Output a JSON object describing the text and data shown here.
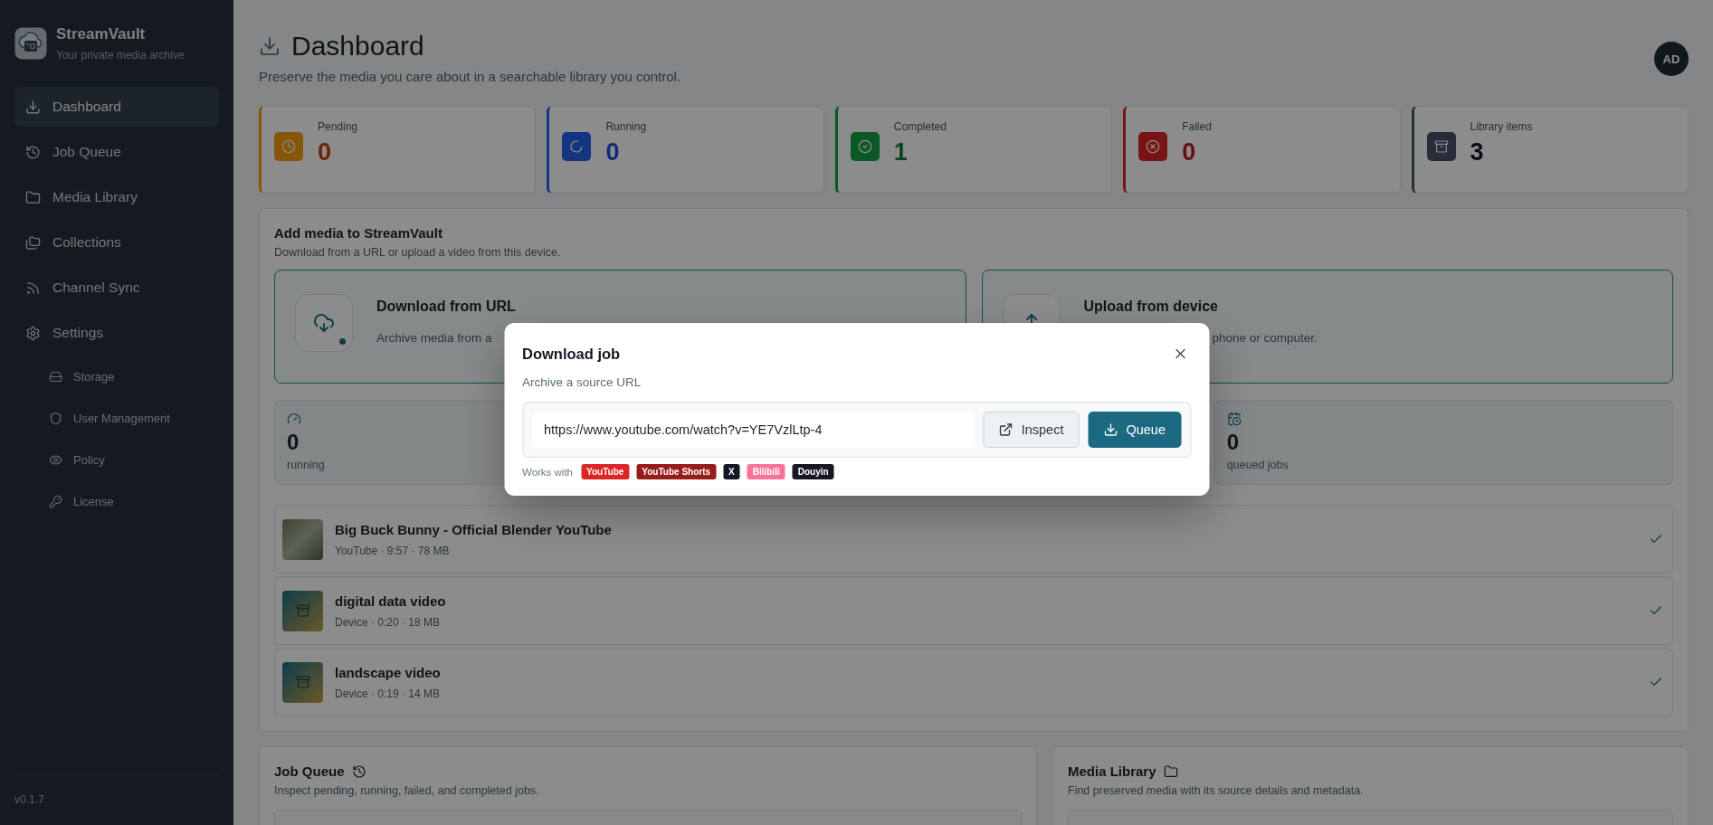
{
  "brand": {
    "name": "StreamVault",
    "tagline": "Your private media archive"
  },
  "nav": [
    {
      "label": "Dashboard",
      "kind": "download",
      "selected": true
    },
    {
      "label": "Job Queue",
      "kind": "history",
      "selected": false
    },
    {
      "label": "Media Library",
      "kind": "folder",
      "selected": false
    },
    {
      "label": "Collections",
      "kind": "folders",
      "selected": false
    },
    {
      "label": "Channel Sync",
      "kind": "rss",
      "selected": false
    },
    {
      "label": "Settings",
      "kind": "settings",
      "selected": false,
      "children": [
        {
          "label": "Storage",
          "kind": "drive",
          "selected": false
        },
        {
          "label": "User Management",
          "kind": "shield",
          "selected": false
        },
        {
          "label": "Policy",
          "kind": "eye",
          "selected": false
        },
        {
          "label": "License",
          "kind": "key",
          "selected": false
        }
      ]
    }
  ],
  "version": "v0.1.7",
  "header": {
    "title": "Dashboard",
    "subtitle": "Preserve the media you care about in a searchable library you control.",
    "avatar": "AD"
  },
  "stats": [
    {
      "label": "Pending",
      "value": "0",
      "kind": "pending"
    },
    {
      "label": "Running",
      "value": "0",
      "kind": "running"
    },
    {
      "label": "Completed",
      "value": "1",
      "kind": "completed"
    },
    {
      "label": "Failed",
      "value": "0",
      "kind": "failed"
    },
    {
      "label": "Library items",
      "value": "3",
      "kind": "library"
    }
  ],
  "add_media": {
    "title": "Add media to StreamVault",
    "subtitle": "Download from a URL or upload a video from this device.",
    "options": [
      {
        "title": "Download from URL",
        "description": "Archive media from a",
        "kind": "url"
      },
      {
        "title": "Upload from device",
        "description": "phone or computer.",
        "kind": "upload"
      }
    ],
    "summary": [
      {
        "value": "0",
        "label": "running",
        "kind": "gauge"
      },
      {
        "value": "0",
        "label": "queued jobs",
        "kind": "calendar"
      }
    ],
    "recent": [
      {
        "title": "Big Buck Bunny - Official Blender YouTube",
        "meta": "YouTube · 9:57 · 78 MB",
        "kind": "photo"
      },
      {
        "title": "digital data video",
        "meta": "Device · 0:20 · 18 MB",
        "kind": "archive"
      },
      {
        "title": "landscape video",
        "meta": "Device · 0:19 · 14 MB",
        "kind": "archive"
      }
    ]
  },
  "panels": [
    {
      "title": "Job Queue",
      "description": "Inspect pending, running, failed, and completed jobs.",
      "kind": "history"
    },
    {
      "title": "Media Library",
      "description": "Find preserved media with its source details and metadata.",
      "kind": "folder"
    }
  ],
  "dialog": {
    "title": "Download job",
    "subtitle": "Archive a source URL",
    "url": "https://www.youtube.com/watch?v=YE7VzlLtp-4",
    "buttons": [
      {
        "label": "Inspect",
        "kind": "secondary"
      },
      {
        "label": "Queue",
        "kind": "primary"
      }
    ],
    "works_with": "Works with",
    "platforms": [
      {
        "label": "YouTube",
        "color": "#dc2626"
      },
      {
        "label": "YouTube Shorts",
        "color": "#991b1b"
      },
      {
        "label": "X",
        "color": "#111827"
      },
      {
        "label": "Bilibili",
        "color": "#fb7299"
      },
      {
        "label": "Douyin",
        "color": "#161823"
      }
    ]
  }
}
